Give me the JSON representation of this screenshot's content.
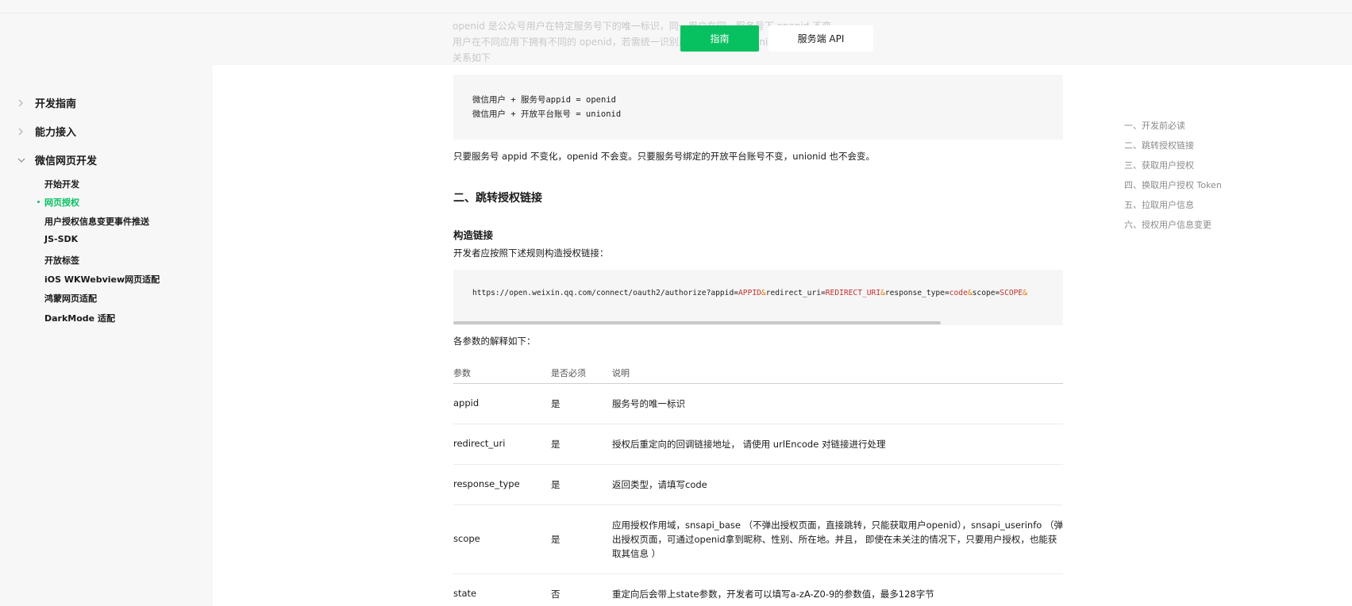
{
  "header": {
    "ghost_lines": [
      "openid 是公众号用户在特定服务号下的唯一标识，同一用户在同一服务号下 openid 不变，",
      "用户在不同应用下拥有不同的 openid，若需统一识别用户，可通过 unionid 区分",
      "关系如下："
    ],
    "tabs": [
      {
        "label": "指南",
        "active": true
      },
      {
        "label": "服务端 API",
        "active": false
      }
    ]
  },
  "sidebar": {
    "groups": [
      {
        "label": "开发指南",
        "expanded": false
      },
      {
        "label": "能力接入",
        "expanded": false
      },
      {
        "label": "微信网页开发",
        "expanded": true
      }
    ],
    "children": [
      {
        "label": "开始开发",
        "active": false
      },
      {
        "label": "网页授权",
        "active": true
      },
      {
        "label": "用户授权信息变更事件推送",
        "active": false
      },
      {
        "label": "JS-SDK",
        "active": false
      },
      {
        "label": "开放标签",
        "active": false
      },
      {
        "label": "iOS WKWebview网页适配",
        "active": false
      },
      {
        "label": "鸿蒙网页适配",
        "active": false
      },
      {
        "label": "DarkMode 适配",
        "active": false
      }
    ]
  },
  "main": {
    "code1": [
      "微信用户 + 服务号appid = openid",
      "微信用户 + 开放平台账号 = unionid"
    ],
    "note": "只要服务号 appid 不变化，openid 不会变。只要服务号绑定的开放平台账号不变，unionid 也不会变。",
    "section_title": "二、跳转授权链接",
    "subsection_title": "构造链接",
    "subsection_intro": "开发者应按照下述规则构造授权链接：",
    "url_parts": {
      "base": "https://open.weixin.qq.com/connect/oauth2/authorize?appid=",
      "appid": "APPID",
      "p1": "redirect_uri=",
      "redirect": "REDIRECT_URI",
      "p2": "response_type=",
      "rtype": "code",
      "p3": "scope=",
      "scope": "SCOPE",
      "amp": "&"
    },
    "params_intro": "各参数的解释如下：",
    "table": {
      "headers": [
        "参数",
        "是否必须",
        "说明"
      ],
      "rows": [
        {
          "param": "appid",
          "required": "是",
          "desc": "服务号的唯一标识"
        },
        {
          "param": "redirect_uri",
          "required": "是",
          "desc": "授权后重定向的回调链接地址， 请使用 urlEncode 对链接进行处理"
        },
        {
          "param": "response_type",
          "required": "是",
          "desc": "返回类型，请填写code"
        },
        {
          "param": "scope",
          "required": "是",
          "desc": "应用授权作用域，snsapi_base （不弹出授权页面，直接跳转，只能获取用户openid），snsapi_userinfo （弹出授权页面，可通过openid拿到昵称、性别、所在地。并且， 即使在未关注的情况下，只要用户授权，也能获取其信息 ）"
        },
        {
          "param": "state",
          "required": "否",
          "desc": "重定向后会带上state参数，开发者可以填写a-zA-Z0-9的参数值，最多128字节"
        }
      ]
    }
  },
  "toc": {
    "items": [
      "一、开发前必读",
      "二、跳转授权链接",
      "三、获取用户授权",
      "四、换取用户授权 Token",
      "五、拉取用户信息",
      "六、授权用户信息变更"
    ]
  },
  "colors": {
    "accent": "#07c160",
    "sidebar_bg": "#f7f7f7",
    "code_bg": "#f6f6f6",
    "toc_text": "#8a8a8a"
  }
}
